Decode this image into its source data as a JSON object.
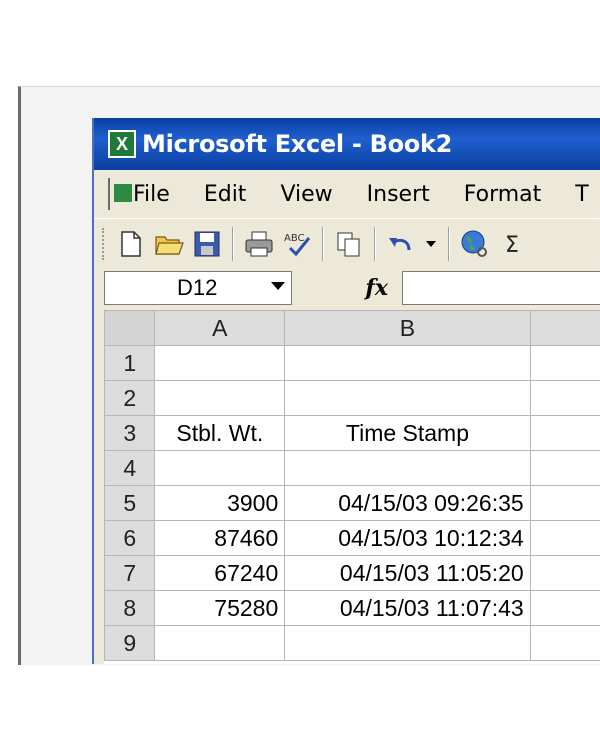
{
  "window": {
    "title": "Microsoft Excel - Book2"
  },
  "menu": [
    "File",
    "Edit",
    "View",
    "Insert",
    "Format",
    "T"
  ],
  "toolbar": {
    "icons": [
      "new-document-icon",
      "open-folder-icon",
      "save-icon",
      "print-icon",
      "spelling-icon",
      "copy-icon",
      "undo-icon",
      "dropdown-arrow-icon",
      "web-globe-icon",
      "autosum-icon"
    ],
    "glyphs": {
      "new": "🗋",
      "open": "📂",
      "save": "💾",
      "print": "🖶",
      "spell": "ᴬᴮᶜ✓",
      "copy": "⧉",
      "undo": "↶",
      "drop": "▾",
      "web": "🌐",
      "sum": "Σ"
    }
  },
  "formula_bar": {
    "name_box": "D12",
    "fx": "fx"
  },
  "columns": [
    "A",
    "B"
  ],
  "rows": [
    {
      "num": "1",
      "a": "",
      "b": ""
    },
    {
      "num": "2",
      "a": "",
      "b": ""
    },
    {
      "num": "3",
      "a": "Stbl. Wt.",
      "b": "Time Stamp"
    },
    {
      "num": "4",
      "a": "",
      "b": ""
    },
    {
      "num": "5",
      "a": "3900",
      "b": "04/15/03 09:26:35"
    },
    {
      "num": "6",
      "a": "87460",
      "b": "04/15/03 10:12:34"
    },
    {
      "num": "7",
      "a": "67240",
      "b": "04/15/03 11:05:20"
    },
    {
      "num": "8",
      "a": "75280",
      "b": "04/15/03 11:07:43"
    },
    {
      "num": "9",
      "a": "",
      "b": ""
    }
  ]
}
